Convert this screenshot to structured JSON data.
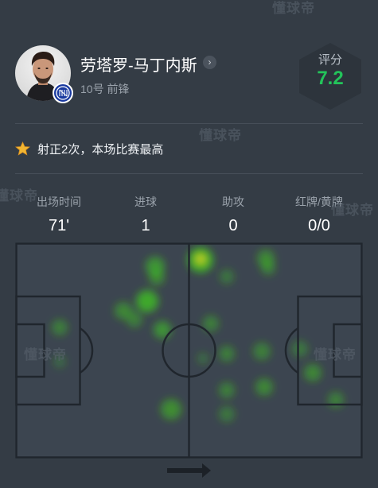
{
  "player": {
    "name": "劳塔罗-马丁内斯",
    "number_position": "10号 前锋"
  },
  "rating": {
    "label": "评分",
    "value": "7.2",
    "color": "#23c45a"
  },
  "highlight": {
    "icon": "star-icon",
    "text": "射正2次，本场比赛最高"
  },
  "stats": [
    {
      "label": "出场时间",
      "value": "71'"
    },
    {
      "label": "进球",
      "value": "1"
    },
    {
      "label": "助攻",
      "value": "0"
    },
    {
      "label": "红牌/黄牌",
      "value": "0/0"
    }
  ],
  "watermark": "懂球帝",
  "heatmap": {
    "attack_direction": "right",
    "heat_color": "#3fd21c",
    "peak_color": "#e0d824"
  }
}
